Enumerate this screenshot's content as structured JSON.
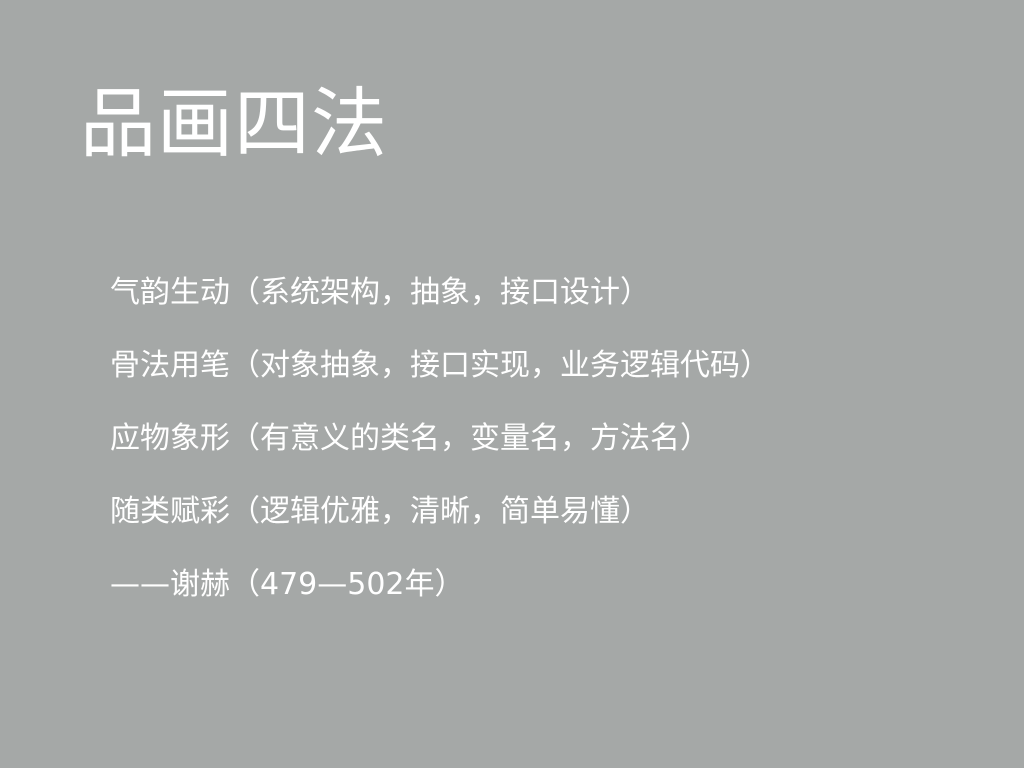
{
  "slide": {
    "title": "品画四法",
    "lines": [
      "气韵生动（系统架构，抽象，接口设计）",
      "骨法用笔（对象抽象，接口实现，业务逻辑代码）",
      "应物象形（有意义的类名，变量名，方法名）",
      "随类赋彩（逻辑优雅，清晰，简单易懂）",
      "——谢赫（479—502年）"
    ]
  }
}
